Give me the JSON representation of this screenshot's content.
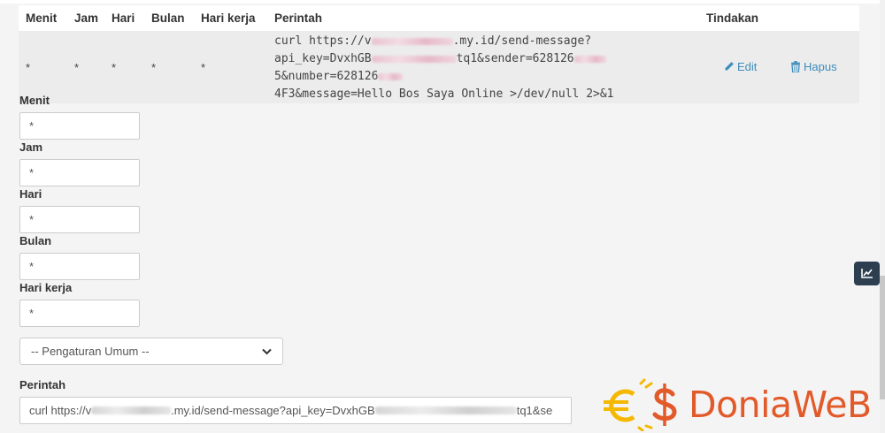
{
  "table": {
    "headers": {
      "minute": "Menit",
      "hour": "Jam",
      "day": "Hari",
      "month": "Bulan",
      "weekday": "Hari kerja",
      "command": "Perintah",
      "actions": "Tindakan"
    },
    "row": {
      "minute": "*",
      "hour": "*",
      "day": "*",
      "month": "*",
      "weekday": "*",
      "command_line1_start": "curl https://v",
      "command_line1_end": ".my.id/send-message?",
      "command_line2_start": "api_key=DvxhGB",
      "command_line2_mid": "tq1&sender=628126",
      "command_line2_mid2": "5&number=628126",
      "command_line3_end": "4F3&message=Hello Bos Saya Online >/dev/null 2>&1",
      "edit_label": "Edit",
      "delete_label": "Hapus"
    }
  },
  "form": {
    "minute_label": "Menit",
    "minute_value": "*",
    "hour_label": "Jam",
    "hour_value": "*",
    "day_label": "Hari",
    "day_value": "*",
    "month_label": "Bulan",
    "month_value": "*",
    "weekday_label": "Hari kerja",
    "weekday_value": "*",
    "preset_selected": "-- Pengaturan Umum --",
    "command_label": "Perintah",
    "command_value_start": "curl https://v",
    "command_value_mid": ".my.id/send-message?api_key=DvxhGB",
    "command_value_end": "tq1&se"
  },
  "watermark": {
    "brand": "DoniaWeB"
  },
  "icons": {
    "edit": "pencil-icon",
    "delete": "trash-icon",
    "side": "chart-line-icon"
  },
  "colors": {
    "link": "#3c8dbc",
    "code": "#c7254e",
    "brand_orange": "#e25a2a",
    "brand_gold": "#f5b800",
    "side_button": "#2d3e50"
  }
}
